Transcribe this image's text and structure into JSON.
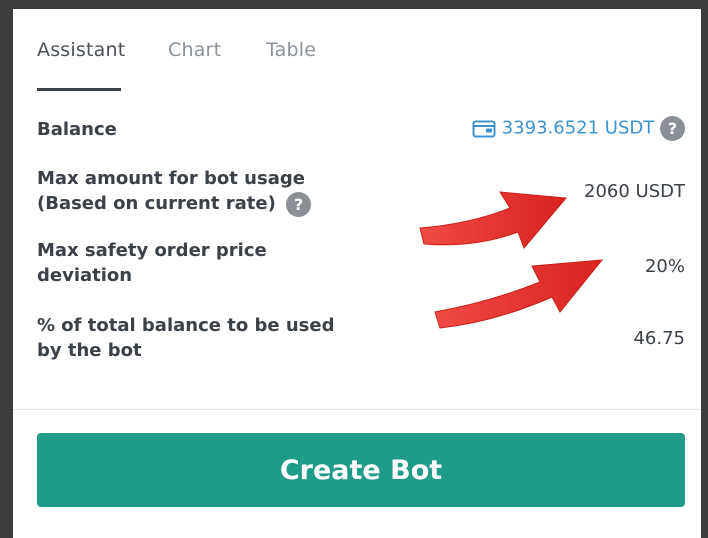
{
  "tabs": [
    {
      "label": "Assistant",
      "active": true
    },
    {
      "label": "Chart",
      "active": false
    },
    {
      "label": "Table",
      "active": false
    }
  ],
  "rows": {
    "balance": {
      "label": "Balance",
      "value": "3393.6521 USDT"
    },
    "max_amount": {
      "label_line1": "Max amount for bot usage",
      "label_line2": "(Based on current rate)",
      "value": "2060 USDT"
    },
    "max_safety": {
      "label_line1": "Max safety order price",
      "label_line2": "deviation",
      "value": "20%"
    },
    "pct_balance": {
      "label_line1": "% of total balance to be used",
      "label_line2": "by the bot",
      "value": "46.75"
    }
  },
  "help_glyph": "?",
  "button": {
    "label": "Create Bot"
  },
  "colors": {
    "accent": "#1f9b88",
    "balance": "#3c93d3",
    "arrow": "#e8322f",
    "frame": "#3d3d3d"
  },
  "icons": [
    "wallet-icon",
    "help-icon",
    "annotation-arrow"
  ]
}
